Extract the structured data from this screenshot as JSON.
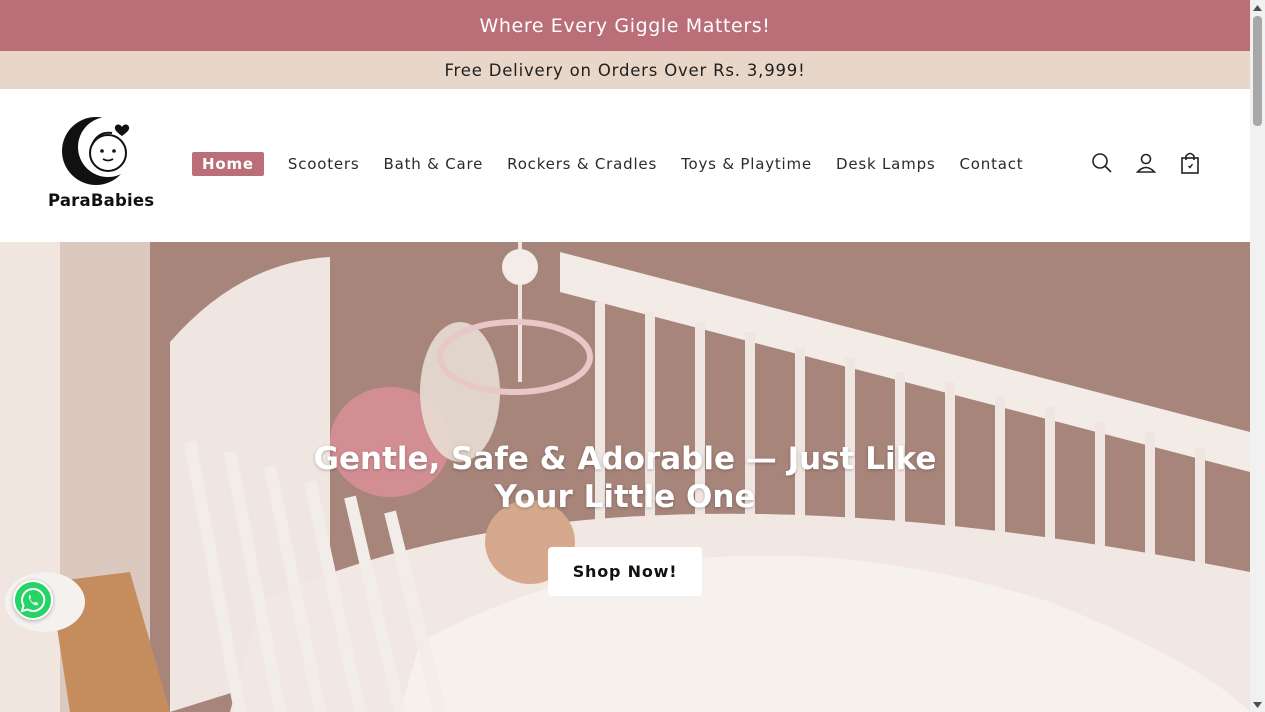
{
  "announcements": {
    "primary": "Where Every Giggle Matters!",
    "secondary": "Free Delivery on Orders Over Rs. 3,999!"
  },
  "brand": {
    "name": "ParaBabies"
  },
  "nav": {
    "items": [
      {
        "label": "Home",
        "active": true
      },
      {
        "label": "Scooters"
      },
      {
        "label": "Bath & Care"
      },
      {
        "label": "Rockers & Cradles"
      },
      {
        "label": "Toys & Playtime"
      },
      {
        "label": "Desk Lamps"
      },
      {
        "label": "Contact"
      }
    ]
  },
  "header_icons": [
    "search-icon",
    "account-icon",
    "cart-icon"
  ],
  "hero": {
    "title": "Gentle, Safe & Adorable — Just Like Your Little One",
    "cta": "Shop Now!"
  },
  "colors": {
    "brand_pink": "#b96e78",
    "banner_beige": "#e8d6c8",
    "whatsapp_green": "#25d366"
  }
}
